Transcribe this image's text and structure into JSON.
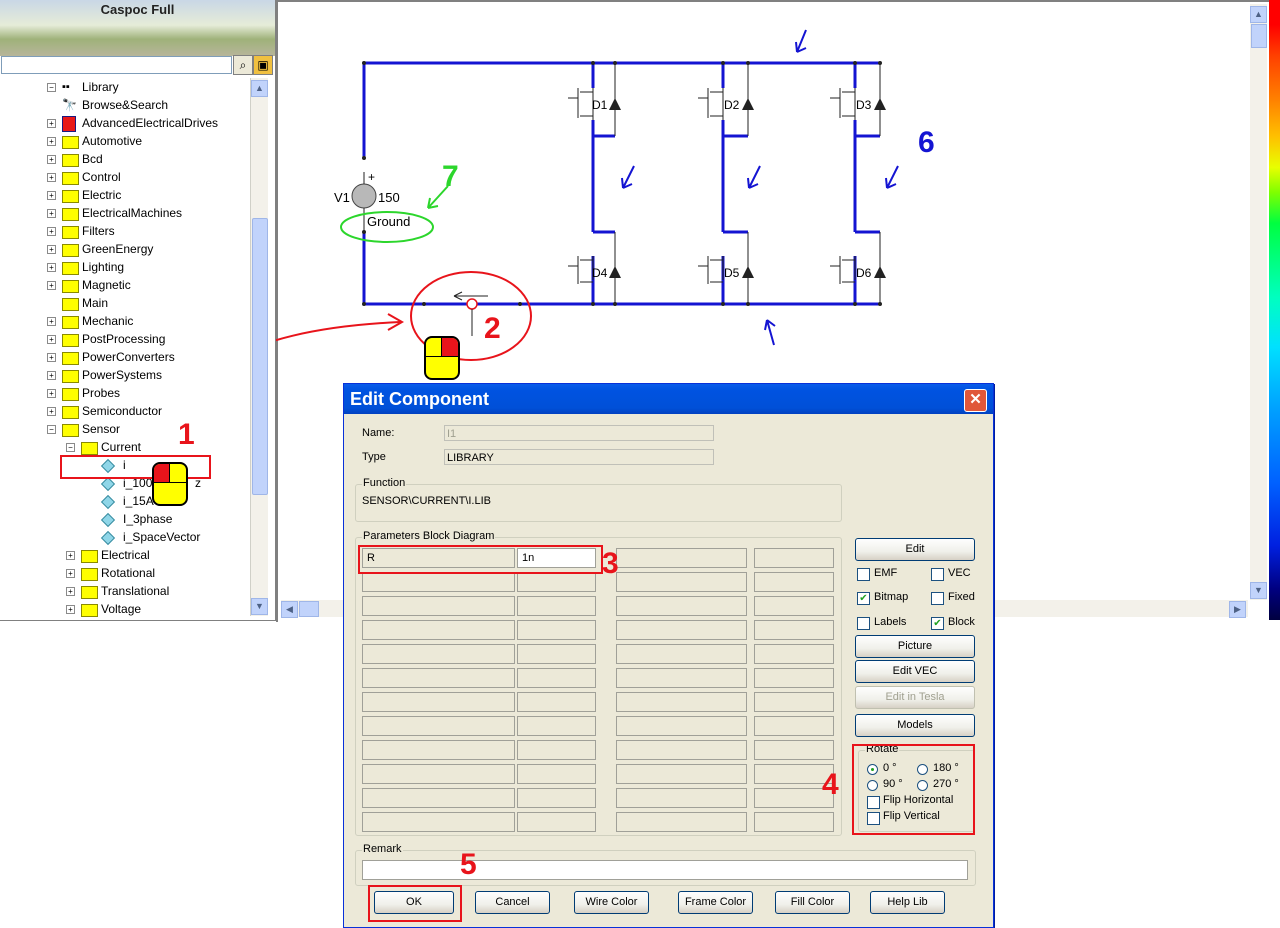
{
  "app": {
    "title": "Caspoc Full"
  },
  "left_panel": {
    "search": {
      "value": "",
      "placeholder": ""
    },
    "tree": [
      {
        "label": "Library",
        "kind": "root"
      },
      {
        "label": "Browse&Search",
        "kind": "search"
      },
      {
        "label": "AdvancedElectricalDrives",
        "kind": "book"
      },
      {
        "label": "Automotive",
        "kind": "folder"
      },
      {
        "label": "Bcd",
        "kind": "folder"
      },
      {
        "label": "Control",
        "kind": "folder"
      },
      {
        "label": "Electric",
        "kind": "folder"
      },
      {
        "label": "ElectricalMachines",
        "kind": "folder"
      },
      {
        "label": "Filters",
        "kind": "folder"
      },
      {
        "label": "GreenEnergy",
        "kind": "folder"
      },
      {
        "label": "Lighting",
        "kind": "folder"
      },
      {
        "label": "Magnetic",
        "kind": "folder"
      },
      {
        "label": "Main",
        "kind": "folder"
      },
      {
        "label": "Mechanic",
        "kind": "folder"
      },
      {
        "label": "PostProcessing",
        "kind": "folder"
      },
      {
        "label": "PowerConverters",
        "kind": "folder"
      },
      {
        "label": "PowerSystems",
        "kind": "folder"
      },
      {
        "label": "Probes",
        "kind": "folder"
      },
      {
        "label": "Semiconductor",
        "kind": "folder"
      },
      {
        "label": "Sensor",
        "kind": "folder"
      },
      {
        "label": "Current",
        "kind": "folder"
      },
      {
        "label": "i",
        "kind": "item"
      },
      {
        "label": "i_100",
        "suffix": "z",
        "kind": "item"
      },
      {
        "label": "i_15A",
        "kind": "item"
      },
      {
        "label": "I_3phase",
        "kind": "item"
      },
      {
        "label": "i_SpaceVector",
        "kind": "item"
      },
      {
        "label": "Electrical",
        "kind": "folder"
      },
      {
        "label": "Rotational",
        "kind": "folder"
      },
      {
        "label": "Translational",
        "kind": "folder"
      },
      {
        "label": "Voltage",
        "kind": "folder"
      }
    ]
  },
  "schematic": {
    "source": {
      "name": "V1",
      "value": "150",
      "plus": "+"
    },
    "ground_label": "Ground",
    "switches": [
      "D1",
      "D2",
      "D3",
      "D4",
      "D5",
      "D6"
    ]
  },
  "annotations": {
    "n1": "1",
    "n2": "2",
    "n3": "3",
    "n4": "4",
    "n5": "5",
    "n6": "6",
    "n7": "7"
  },
  "dialog": {
    "title": "Edit Component",
    "close": "✕",
    "name_label": "Name:",
    "name_value": "I1",
    "type_label": "Type",
    "type_value": "LIBRARY",
    "function_title": "Function",
    "function_value": "SENSOR\\CURRENT\\I.LIB",
    "params_title": "Parameters Block Diagram",
    "param_name": "R",
    "param_value": "1n",
    "buttons": {
      "edit": "Edit",
      "picture": "Picture",
      "edit_vec": "Edit VEC",
      "edit_tesla": "Edit in Tesla",
      "models": "Models",
      "ok": "OK",
      "cancel": "Cancel",
      "wire_color": "Wire Color",
      "frame_color": "Frame Color",
      "fill_color": "Fill Color",
      "help_lib": "Help Lib"
    },
    "checkboxes": {
      "emf": {
        "label": "EMF",
        "checked": false
      },
      "vec": {
        "label": "VEC",
        "checked": false
      },
      "bitmap": {
        "label": "Bitmap",
        "checked": true
      },
      "fixed": {
        "label": "Fixed",
        "checked": false
      },
      "labels": {
        "label": "Labels",
        "checked": false
      },
      "block": {
        "label": "Block",
        "checked": true
      }
    },
    "rotate": {
      "title": "Rotate",
      "options": [
        "0 °",
        "180 °",
        "90 °",
        "270 °"
      ],
      "selected": "0 °",
      "flip_h": "Flip Horizontal",
      "flip_v": "Flip Vertical"
    },
    "remark_title": "Remark",
    "remark_value": ""
  }
}
